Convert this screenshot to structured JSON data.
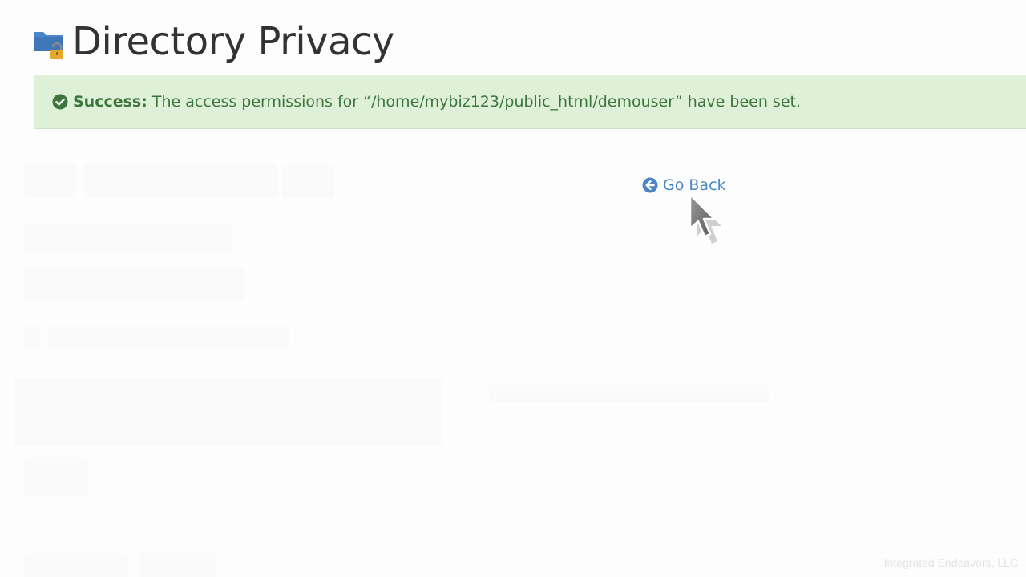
{
  "header": {
    "title": "Directory Privacy",
    "icon": "folder-lock-icon"
  },
  "alert": {
    "type": "success",
    "icon": "check-circle-icon",
    "label": "Success:",
    "message": "The access permissions for “/home/mybiz123/public_html/demouser” have been set.",
    "color": "#3c763d",
    "background": "#dff0d8"
  },
  "actions": {
    "go_back_label": "Go Back",
    "go_back_icon": "arrow-circle-left-icon",
    "link_color": "#4a86c5"
  },
  "watermark": {
    "text": "Integrated Endeavors, LLC"
  }
}
